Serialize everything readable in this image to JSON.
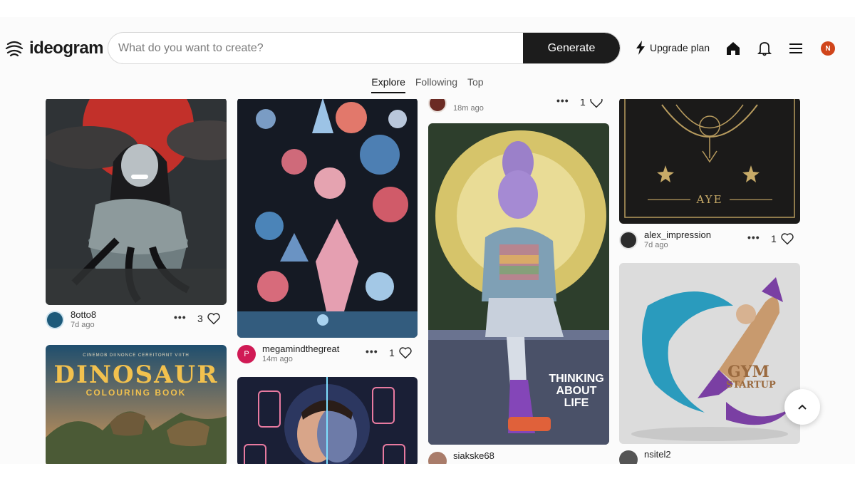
{
  "brand": {
    "name": "ideogram"
  },
  "search": {
    "placeholder": "What do you want to create?",
    "button_label": "Generate"
  },
  "header": {
    "upgrade_label": "Upgrade plan",
    "user_initial": "N"
  },
  "tabs": [
    {
      "label": "Explore",
      "active": true
    },
    {
      "label": "Following",
      "active": false
    },
    {
      "label": "Top",
      "active": false
    }
  ],
  "posts": {
    "c1p1": {
      "user": "8otto8",
      "ago": "7d ago",
      "likes": "3"
    },
    "c2p1": {
      "user": "megamindthegreat",
      "ago": "14m ago",
      "likes": "1"
    },
    "c3p0": {
      "user": "",
      "ago": "18m ago",
      "likes": "1"
    },
    "c3p1": {
      "user": "siakske68",
      "ago": "",
      "likes": ""
    },
    "c4p1": {
      "user": "alex_impression",
      "ago": "7d ago",
      "likes": "1"
    },
    "c4p2": {
      "user": "nsitel2",
      "ago": "",
      "likes": ""
    }
  },
  "image_text": {
    "dino_title": "DINOSAUR",
    "dino_sub": "COLOURING BOOK",
    "dino_top": "CINEMOB DIINONCE CEREITORNT VIITH",
    "buddha_1": "THINKING",
    "buddha_2": "ABOUT",
    "buddha_3": "LIFE",
    "aye": "AYE",
    "gym_1": "GYM",
    "gym_2": "STARTUP"
  },
  "colors": {
    "accent": "#1c1c1c",
    "avatar": "#d0451b"
  }
}
